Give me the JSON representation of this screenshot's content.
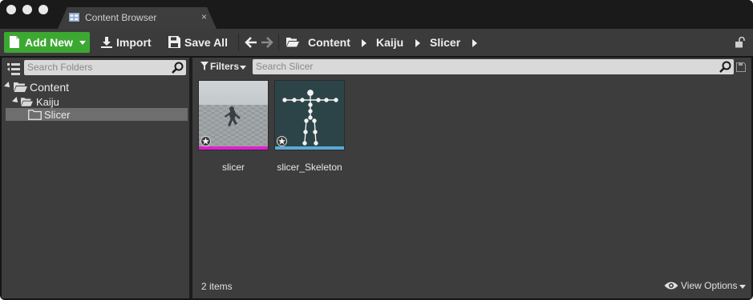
{
  "window": {
    "tab": {
      "label": "Content Browser",
      "close_glyph": "×",
      "icon": "content-browser-icon"
    },
    "traffic_lights": [
      "close",
      "minimize",
      "zoom"
    ]
  },
  "toolbar": {
    "add_new_label": "Add New",
    "import_label": "Import",
    "save_all_label": "Save All",
    "breadcrumb": [
      "Content",
      "Kaiju",
      "Slicer"
    ],
    "accent_color": "#3ca832"
  },
  "sources": {
    "search_placeholder": "Search Folders",
    "tree": [
      {
        "label": "Content",
        "level": 0,
        "expanded": true
      },
      {
        "label": "Kaiju",
        "level": 1,
        "expanded": true
      },
      {
        "label": "Slicer",
        "level": 2,
        "selected": true
      }
    ]
  },
  "assets": {
    "filters_label": "Filters",
    "search_placeholder": "Search Slicer",
    "items": [
      {
        "name": "slicer",
        "type_color": "#e020d0",
        "thumbnail": "animated-character-preview"
      },
      {
        "name": "slicer_Skeleton",
        "type_color": "#5aa9d6",
        "thumbnail": "skeleton-preview"
      }
    ],
    "items_count": "2 items",
    "view_options_label": "View Options"
  }
}
